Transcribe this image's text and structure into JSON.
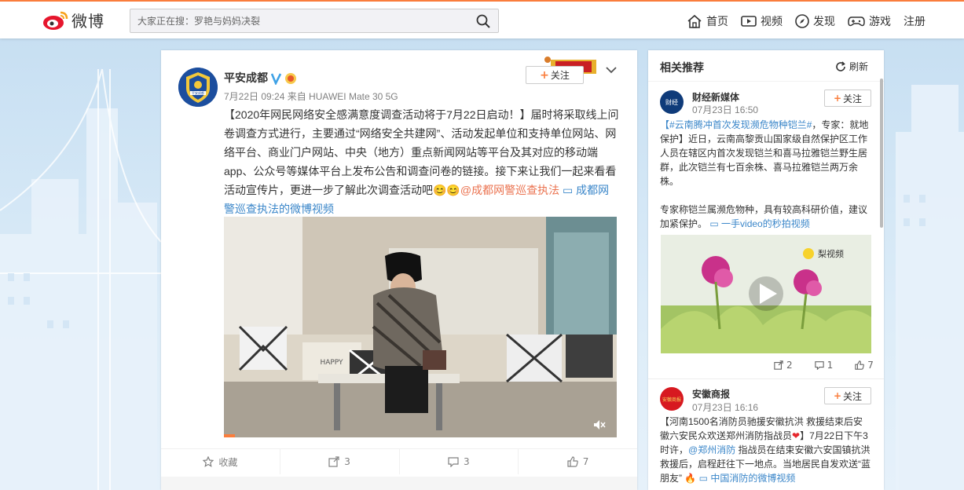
{
  "app": {
    "logo_text": "微博"
  },
  "search": {
    "placeholder": "大家正在搜：罗艳与妈妈决裂"
  },
  "nav": [
    {
      "label": "首页",
      "icon": "home-icon"
    },
    {
      "label": "视频",
      "icon": "video-icon"
    },
    {
      "label": "发现",
      "icon": "compass-icon"
    },
    {
      "label": "游戏",
      "icon": "game-icon"
    },
    {
      "label": "注册",
      "icon": ""
    }
  ],
  "post": {
    "author": "平安成都",
    "avatar_label": "平安成都",
    "meta": "7月22日 09:24 来自 HUAWEI Mate 30 5G",
    "follow_label": "关注",
    "text_part1": "【2020年网民网络安全感满意度调查活动将于7月22日启动！】届时将采取线上问卷调查方式进行，主要通过“网络安全共建网”、活动发起单位和支持单位网站、网络平台、商业门户网站、中央（地方）重点新闻网站等平台及其对应的移动端app、公众号等媒体平台上发布公告和调查问卷的链接。接下来让我们一起来看看活动宣传片，更进一步了解此次调查活动吧",
    "emoji": "😊😊",
    "mention": "@成都网警巡查执法",
    "video_link": "成都网警巡查执法的微博视频",
    "pillow_text": "HAPPY",
    "actions": {
      "favorite": "收藏",
      "repost": "3",
      "comment": "3",
      "like": "7"
    }
  },
  "sidebar": {
    "title": "相关推荐",
    "refresh": "刷新",
    "cards": [
      {
        "name": "财经新媒体",
        "avatar_label": "财经",
        "time": "07月23日 16:50",
        "follow_label": "关注",
        "hashtag": "#云南腾冲首次发现濒危物种铠兰#",
        "text": "，专家：就地保护】近日，云南高黎贡山国家级自然保护区工作人员在辖区内首次发现铠兰和喜马拉雅铠兰野生居群，此次铠兰有七百余株、喜马拉雅铠兰两万余株。",
        "text2": "专家称铠兰属濒危物种，具有较高科研价值，建议加紧保护。",
        "video_link": "一手video的秒拍视频",
        "video_badge": "梨视频",
        "reposts": "2",
        "comments": "1",
        "likes": "7"
      },
      {
        "name": "安徽商报",
        "avatar_label": "安徽商报",
        "time": "07月23日 16:16",
        "follow_label": "关注",
        "text_a": "【河南1500名消防员驰援安徽抗洪 救援结束后安徽六安民众欢送郑州消防指战员",
        "text_b": "】7月22日下午3时许，",
        "mention": "@郑州消防",
        "text_c": " 指战员在结束安徽六安国镇抗洪救援后，启程赶往下一地点。当地居民自发欢送“蓝朋友”",
        "video_link": "中国消防的微博视频"
      }
    ]
  },
  "colors": {
    "accent": "#fa7d3c",
    "link": "#eb7350",
    "blue_link": "#3a86c9"
  }
}
